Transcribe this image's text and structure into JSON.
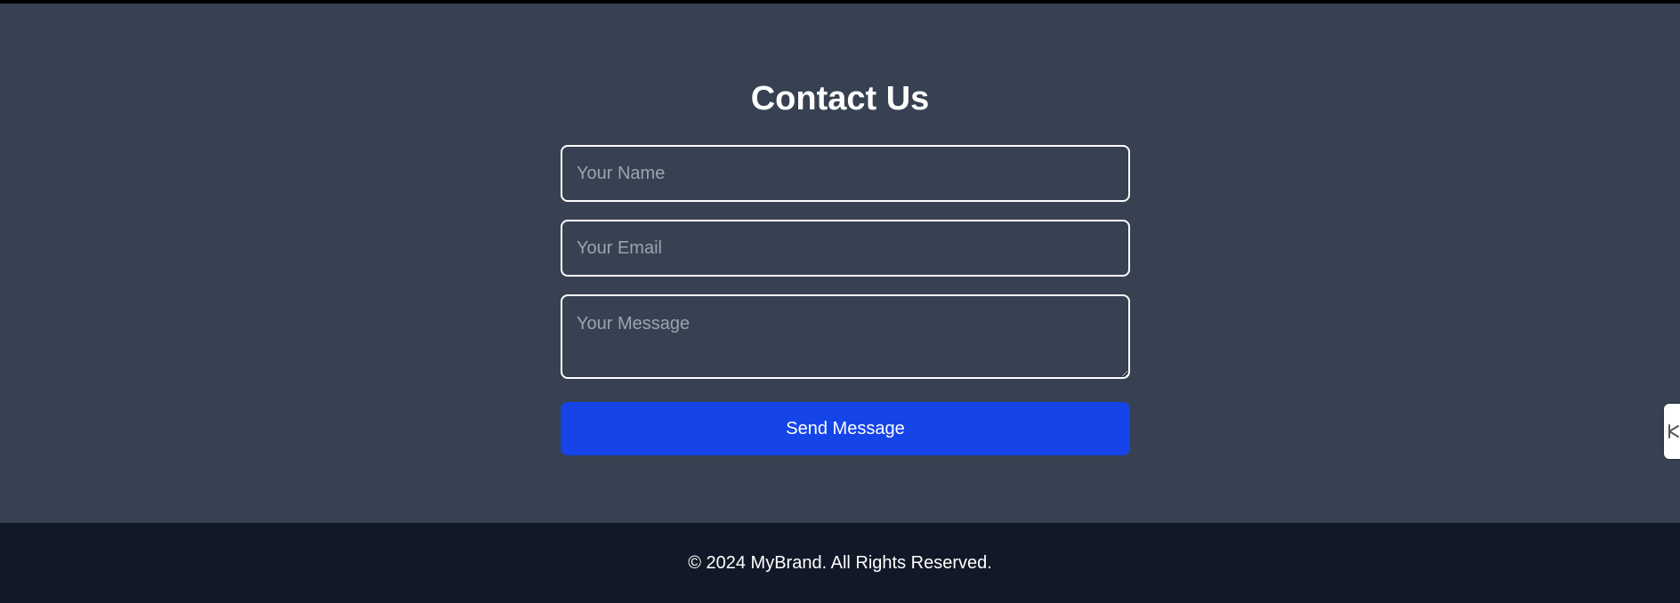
{
  "contact": {
    "title": "Contact Us",
    "name_placeholder": "Your Name",
    "email_placeholder": "Your Email",
    "message_placeholder": "Your Message",
    "submit_label": "Send Message"
  },
  "footer": {
    "copyright": "© 2024 MyBrand. All Rights Reserved."
  },
  "side_tab": {
    "icon": "feedback-icon"
  },
  "colors": {
    "section_background": "#374151",
    "footer_background": "#111827",
    "button_background": "#1545e8",
    "text": "#ffffff",
    "placeholder": "#9ca3af"
  }
}
